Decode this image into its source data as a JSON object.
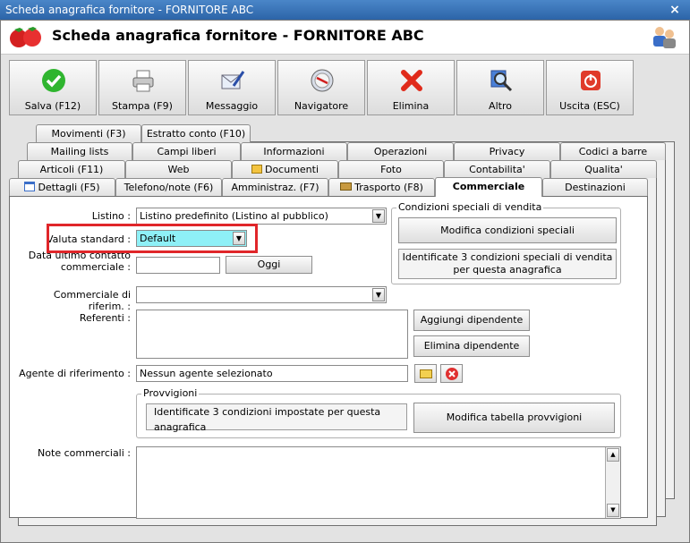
{
  "window": {
    "title": "Scheda anagrafica fornitore - FORNITORE ABC",
    "close": "×"
  },
  "header": {
    "title": "Scheda anagrafica fornitore - FORNITORE ABC"
  },
  "toolbar": {
    "salva": "Salva (F12)",
    "stampa": "Stampa (F9)",
    "messaggio": "Messaggio",
    "navigatore": "Navigatore",
    "elimina": "Elimina",
    "altro": "Altro",
    "uscita": "Uscita (ESC)"
  },
  "tabs": {
    "row1": [
      "Movimenti (F3)",
      "Estratto conto (F10)"
    ],
    "row2": [
      "Mailing lists",
      "Campi liberi",
      "Informazioni",
      "Operazioni",
      "Privacy",
      "Codici a barre"
    ],
    "row3": [
      "Articoli (F11)",
      "Web",
      "Documenti",
      "Foto",
      "Contabilita'",
      "Qualita'"
    ],
    "row4": [
      "Dettagli (F5)",
      "Telefono/note (F6)",
      "Amministraz. (F7)",
      "Trasporto (F8)",
      "Commerciale",
      "Destinazioni"
    ]
  },
  "form": {
    "listino_label": "Listino :",
    "listino_value": "Listino predefinito (Listino al pubblico)",
    "valuta_label": "Valuta standard :",
    "valuta_value": "Default",
    "data_label_1": "Data ultimo contatto",
    "data_label_2": "commerciale :",
    "oggi": "Oggi",
    "commerciale_label": "Commerciale di riferim. :",
    "referenti_label": "Referenti :",
    "aggiungi": "Aggiungi dipendente",
    "elimina_dip": "Elimina dipendente",
    "agente_label": "Agente di riferimento :",
    "agente_value": "Nessun agente selezionato",
    "note_label": "Note commerciali :"
  },
  "condizioni": {
    "title": "Condizioni speciali di vendita",
    "button": "Modifica condizioni speciali",
    "info": "Identificate 3 condizioni speciali di vendita per questa anagrafica"
  },
  "provvigioni": {
    "title": "Provvigioni",
    "info": "Identificate 3 condizioni impostate per questa anagrafica",
    "button": "Modifica tabella provvigioni"
  },
  "colors": {
    "titlebar": "#2c64a8",
    "highlight": "#e0262a",
    "valuta_bg": "#8ef0f7"
  }
}
